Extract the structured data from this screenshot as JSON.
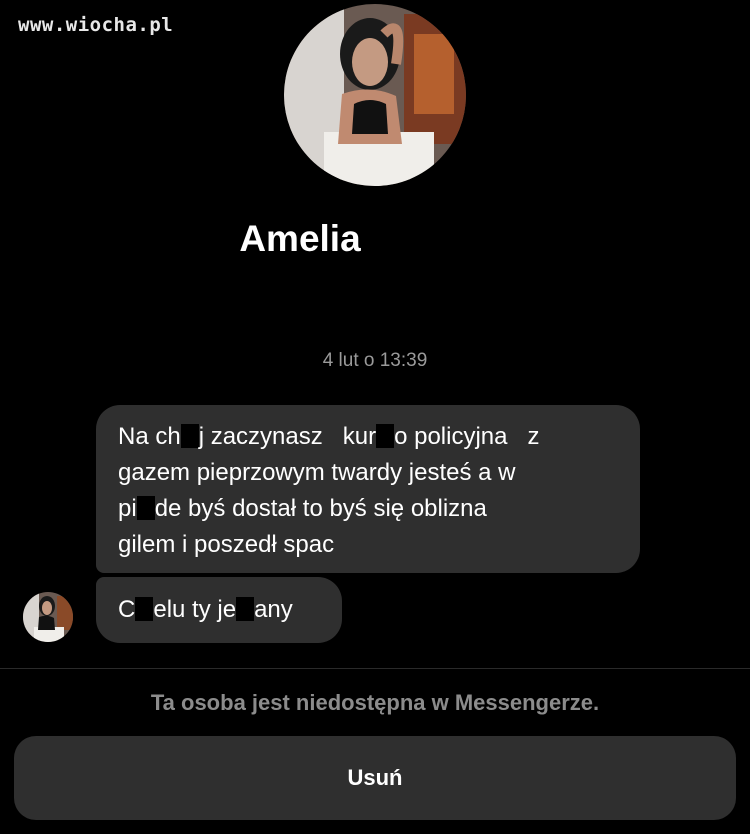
{
  "watermark": "www.wiocha.pl",
  "header": {
    "contact_name": "Amelia"
  },
  "conversation": {
    "timestamp": "4 lut o 13:39",
    "messages": [
      {
        "lines": [
          [
            "Na ch",
            "[redacted]",
            "j zaczynasz   kur",
            "[redacted]",
            "o policyjna   z"
          ],
          [
            "gazem pieprzowym twardy jesteś a w"
          ],
          [
            "pi",
            "[redacted]",
            "de byś dostał to byś się oblizna"
          ],
          [
            "gilem i poszedł spac"
          ]
        ]
      },
      {
        "lines": [
          [
            "C",
            "[redacted]",
            "elu ty je",
            "[redacted]",
            "any"
          ]
        ]
      }
    ]
  },
  "footer": {
    "notice": "Ta osoba jest niedostępna w Messengerze.",
    "delete_label": "Usuń"
  }
}
